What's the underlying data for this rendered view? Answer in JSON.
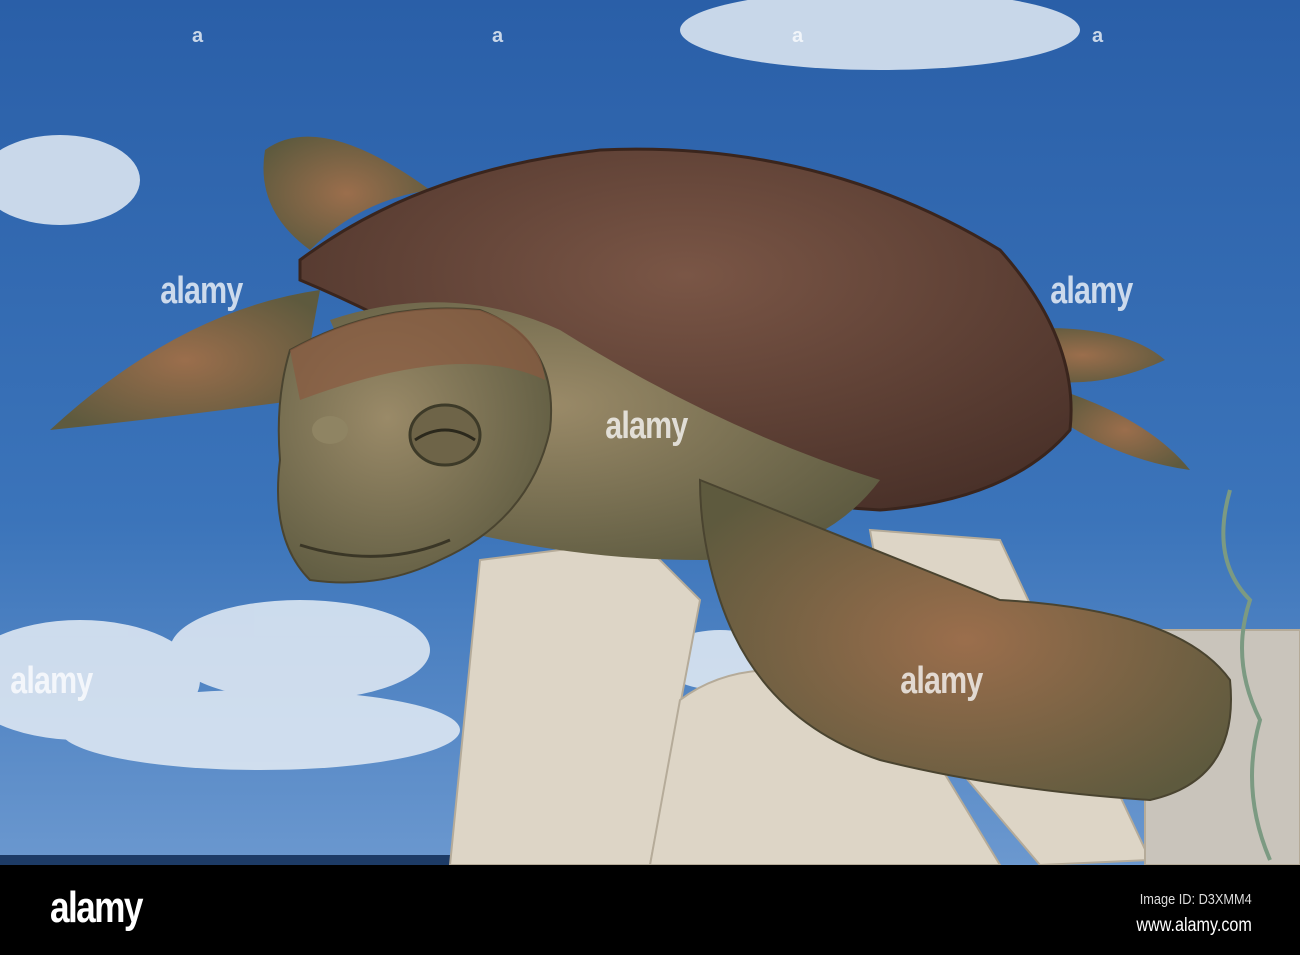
{
  "watermark": {
    "text": "alamy",
    "mark": "a"
  },
  "footer": {
    "logo": "alamy",
    "image_id": "Image ID: D3XMM4",
    "site": "www.alamy.com"
  }
}
